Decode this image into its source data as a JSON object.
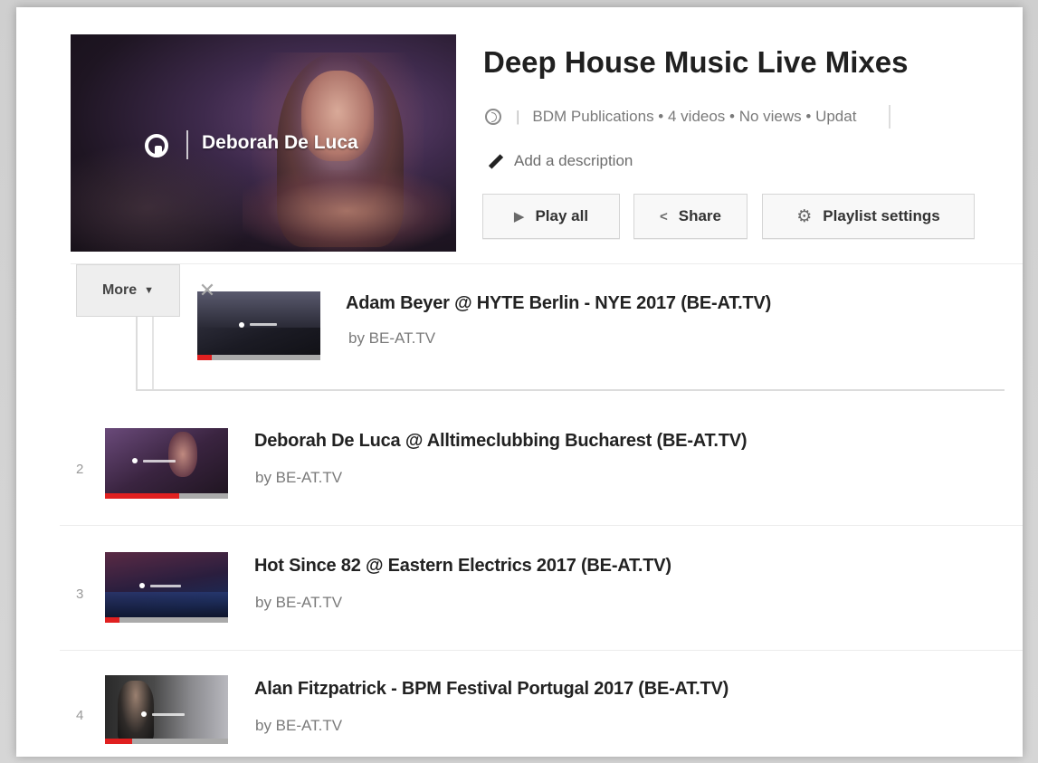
{
  "playlist": {
    "title": "Deep House Music Live Mixes",
    "meta_text": "BDM Publications • 4 videos • No views • Updat",
    "meta_separator": "|",
    "add_description": "Add a description",
    "hero_artist": "Deborah De Luca",
    "hero_icon": "beat-logo-icon"
  },
  "buttons": {
    "play_all": "Play all",
    "play_icon": "▶",
    "share": "Share",
    "share_icon": "<",
    "settings": "Playlist settings",
    "settings_icon": "⚙"
  },
  "drag": {
    "more_label": "More",
    "more_caret": "▼",
    "close_glyph": "✕"
  },
  "videos": [
    {
      "index": "",
      "title": "Adam Beyer @ HYTE Berlin - NYE 2017 (BE-AT.TV)",
      "channel": "by BE-AT.TV",
      "progress": 0.12
    },
    {
      "index": "2",
      "title": "Deborah De Luca @ Alltimeclubbing Bucharest (BE-AT.TV)",
      "channel": "by BE-AT.TV",
      "progress": 0.6
    },
    {
      "index": "3",
      "title": "Hot Since 82 @ Eastern Electrics 2017 (BE-AT.TV)",
      "channel": "by BE-AT.TV",
      "progress": 0.12
    },
    {
      "index": "4",
      "title": "Alan Fitzpatrick - BPM Festival Portugal 2017 (BE-AT.TV)",
      "channel": "by BE-AT.TV",
      "progress": 0.22
    }
  ],
  "colors": {
    "progress": "#e02020",
    "title_text": "#202020",
    "meta_text": "#7a7a7a"
  }
}
